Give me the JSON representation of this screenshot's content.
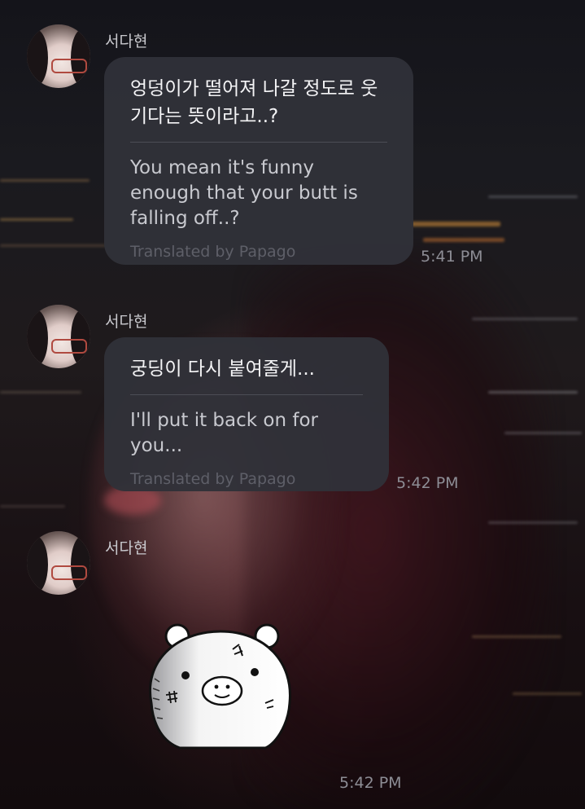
{
  "messages": [
    {
      "sender": "서다현",
      "original": "엉덩이가 떨어져 나갈 정도로 웃기다는 뜻이라고..?",
      "translation": "You mean it's funny enough that your butt is falling off..?",
      "credit": "Translated by Papago",
      "time": "5:41 PM"
    },
    {
      "sender": "서다현",
      "original": "궁딩이 다시 붙여줄게...",
      "translation": "I'll put it back on for you...",
      "credit": "Translated by Papago",
      "time": "5:42 PM"
    },
    {
      "sender": "서다현",
      "sticker": "bear-sticker",
      "time": "5:42 PM"
    }
  ],
  "colors": {
    "bubble": "#303138",
    "original_text": "#f4f4f6",
    "translation_text": "#c8c9cf",
    "credit_text": "#5e5f68",
    "time_text": "#8d8d95"
  }
}
